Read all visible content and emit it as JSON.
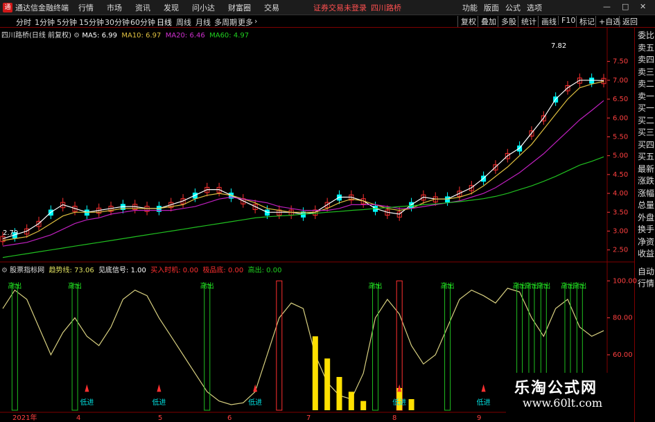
{
  "app": {
    "name": "通达信金融终端",
    "menu": [
      "行情",
      "市场",
      "资讯",
      "发现",
      "问小达",
      "财富圈",
      "交易"
    ],
    "alert": "证券交易未登录",
    "stock": "四川路桥",
    "right_menu": [
      "功能",
      "版面",
      "公式",
      "选项"
    ],
    "window": {
      "min": "—",
      "max": "□",
      "close": "✕"
    }
  },
  "periods": [
    "分时",
    "1分钟",
    "5分钟",
    "15分钟",
    "30分钟",
    "60分钟",
    "日线",
    "周线",
    "月线",
    "多周期",
    "更多"
  ],
  "active_period": "日线",
  "right_tools": [
    "复权",
    "叠加",
    "多股",
    "统计",
    "画线",
    "F10",
    "标记",
    "+自选",
    "返回"
  ],
  "side_panel": [
    "委比",
    "卖五",
    "卖四",
    "卖三",
    "卖二",
    "卖一",
    "买一",
    "买二",
    "买三",
    "买四",
    "买五",
    "最新",
    "涨跌",
    "涨幅",
    "总量",
    "外盘",
    "换手",
    "净资",
    "收益"
  ],
  "side_panel_bottom": [
    "自动",
    "行情"
  ],
  "main_header": {
    "title": "四川路桥(日线 前复权)",
    "ma5": "MA5: 6.99",
    "ma10": "MA10: 6.97",
    "ma20": "MA20: 6.46",
    "ma60": "MA60: 4.97"
  },
  "indicator_header": {
    "name": "股票指标网",
    "trend": "趋势线: 73.06",
    "bottom_signal": "见底信号: 1.00",
    "buy": "买入时机: 0.00",
    "extreme_low": "极品底: 0.00",
    "high_out": "高出: 0.00"
  },
  "annotations": {
    "max_price": "7.82",
    "min_price": "2.79",
    "sell": "高出",
    "buy": "低进"
  },
  "watermark": {
    "title": "乐淘公式网",
    "url": "www.60lt.com"
  },
  "colors": {
    "up": "#ff3030",
    "down": "#00ffff",
    "ma5": "#ffffff",
    "ma10": "#e0c040",
    "ma20": "#c020c0",
    "ma60": "#20c020",
    "trend": "#d8d080",
    "grid": "#800000",
    "axis": "#ff4040"
  },
  "chart_data": [
    {
      "type": "line",
      "title": "四川路桥(日线 前复权)",
      "ylim": [
        2.2,
        8.1
      ],
      "yticks": [
        2.5,
        3.0,
        3.5,
        4.0,
        4.5,
        5.0,
        5.5,
        6.0,
        6.5,
        7.0,
        7.5
      ],
      "series": [
        {
          "name": "MA5",
          "values": [
            2.8,
            2.9,
            3.0,
            3.2,
            3.5,
            3.7,
            3.6,
            3.5,
            3.55,
            3.6,
            3.65,
            3.65,
            3.6,
            3.6,
            3.7,
            3.8,
            3.95,
            4.1,
            4.1,
            3.95,
            3.8,
            3.65,
            3.5,
            3.5,
            3.5,
            3.45,
            3.5,
            3.7,
            3.9,
            3.9,
            3.8,
            3.6,
            3.5,
            3.45,
            3.7,
            3.9,
            3.85,
            3.85,
            4.0,
            4.15,
            4.4,
            4.7,
            5.0,
            5.2,
            5.6,
            6.0,
            6.5,
            6.8,
            7.0,
            7.0,
            6.99
          ]
        },
        {
          "name": "MA10",
          "values": [
            2.75,
            2.8,
            2.85,
            3.0,
            3.2,
            3.4,
            3.5,
            3.5,
            3.5,
            3.55,
            3.6,
            3.6,
            3.6,
            3.6,
            3.65,
            3.7,
            3.85,
            3.95,
            4.0,
            3.95,
            3.85,
            3.75,
            3.6,
            3.55,
            3.5,
            3.5,
            3.5,
            3.6,
            3.75,
            3.85,
            3.8,
            3.7,
            3.6,
            3.55,
            3.6,
            3.75,
            3.85,
            3.85,
            3.9,
            4.0,
            4.2,
            4.45,
            4.7,
            5.0,
            5.3,
            5.7,
            6.1,
            6.5,
            6.8,
            6.9,
            6.97
          ]
        },
        {
          "name": "MA20",
          "values": [
            2.6,
            2.65,
            2.7,
            2.8,
            2.9,
            3.05,
            3.2,
            3.3,
            3.35,
            3.45,
            3.5,
            3.55,
            3.55,
            3.55,
            3.55,
            3.6,
            3.65,
            3.75,
            3.85,
            3.9,
            3.85,
            3.8,
            3.75,
            3.65,
            3.6,
            3.55,
            3.55,
            3.55,
            3.6,
            3.7,
            3.7,
            3.7,
            3.65,
            3.6,
            3.6,
            3.65,
            3.7,
            3.75,
            3.8,
            3.9,
            4.0,
            4.15,
            4.35,
            4.55,
            4.8,
            5.05,
            5.35,
            5.65,
            5.95,
            6.2,
            6.46
          ]
        },
        {
          "name": "MA60",
          "values": [
            2.3,
            2.35,
            2.4,
            2.45,
            2.5,
            2.55,
            2.6,
            2.65,
            2.7,
            2.75,
            2.8,
            2.85,
            2.9,
            2.95,
            3.0,
            3.05,
            3.1,
            3.15,
            3.2,
            3.25,
            3.3,
            3.35,
            3.38,
            3.4,
            3.42,
            3.45,
            3.47,
            3.5,
            3.52,
            3.55,
            3.57,
            3.6,
            3.62,
            3.65,
            3.67,
            3.7,
            3.72,
            3.75,
            3.78,
            3.82,
            3.86,
            3.92,
            4.0,
            4.1,
            4.2,
            4.32,
            4.45,
            4.6,
            4.75,
            4.85,
            4.97
          ]
        }
      ]
    },
    {
      "type": "line",
      "title": "股票指标网",
      "ylim": [
        30,
        105
      ],
      "yticks": [
        40,
        60,
        80,
        100
      ],
      "x": [
        "2021年",
        "4",
        "5",
        "6",
        "7",
        "8",
        "9"
      ],
      "series": [
        {
          "name": "趋势线",
          "values": [
            85,
            95,
            90,
            75,
            60,
            72,
            80,
            70,
            65,
            75,
            90,
            95,
            92,
            80,
            70,
            60,
            50,
            40,
            35,
            33,
            34,
            40,
            60,
            80,
            88,
            85,
            60,
            45,
            38,
            36,
            50,
            80,
            90,
            82,
            65,
            55,
            60,
            75,
            90,
            95,
            92,
            88,
            96,
            94,
            80,
            70,
            85,
            90,
            75,
            70,
            73.06
          ]
        }
      ]
    }
  ]
}
